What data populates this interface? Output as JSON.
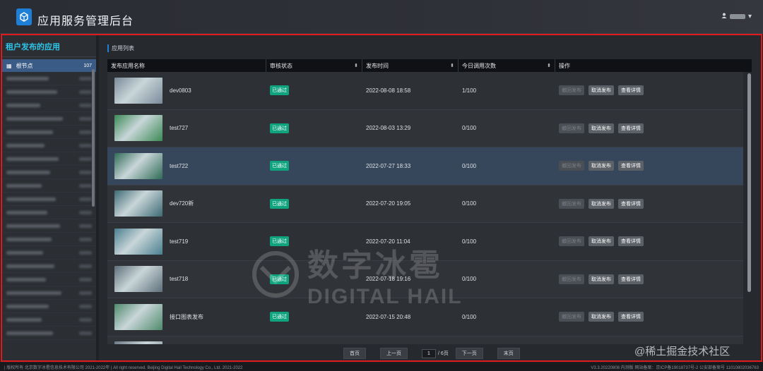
{
  "header": {
    "title": "应用服务管理后台",
    "user_dropdown": "▾"
  },
  "sidebar": {
    "title": "租户发布的应用",
    "root": {
      "icon": "tree-icon",
      "label": "根节点",
      "count": "107"
    },
    "items_count_visible": 20
  },
  "main": {
    "section_title": "应用列表",
    "columns": [
      {
        "label": "发布应用名称",
        "sortable": false
      },
      {
        "label": "审核状态",
        "sortable": true
      },
      {
        "label": "发布时间",
        "sortable": true
      },
      {
        "label": "今日调用次数",
        "sortable": true
      },
      {
        "label": "操作",
        "sortable": false
      }
    ],
    "rows": [
      {
        "name": "dev0803",
        "status": "已通过",
        "time": "2022-08-08 18:58",
        "calls": "1/100",
        "thumb_color": "#7a8a9a"
      },
      {
        "name": "test727",
        "status": "已通过",
        "time": "2022-08-03 13:29",
        "calls": "0/100",
        "thumb_color": "#3b8a55"
      },
      {
        "name": "test722",
        "status": "已通过",
        "time": "2022-07-27 18:33",
        "calls": "0/100",
        "thumb_color": "#2f6b55"
      },
      {
        "name": "dev720新",
        "status": "已通过",
        "time": "2022-07-20 19:05",
        "calls": "0/100",
        "thumb_color": "#3d6a74"
      },
      {
        "name": "test719",
        "status": "已通过",
        "time": "2022-07-20 11:04",
        "calls": "0/100",
        "thumb_color": "#4a7f8f"
      },
      {
        "name": "test718",
        "status": "已通过",
        "time": "2022-07-18 19:16",
        "calls": "0/100",
        "thumb_color": "#5e6f7a"
      },
      {
        "name": "接口图表发布",
        "status": "已通过",
        "time": "2022-07-15 20:48",
        "calls": "0/100",
        "thumb_color": "#4f8a6b"
      },
      {
        "name": "",
        "status": "",
        "time": "",
        "calls": "",
        "thumb_color": "#6c7a86"
      }
    ],
    "actions": {
      "cancel_publish_disabled": "撤回发布",
      "cancel_publish": "取消发布",
      "view_details": "查看详情"
    }
  },
  "pager": {
    "first": "首页",
    "prev": "上一页",
    "current": "1",
    "total": "/ 6页",
    "next": "下一页",
    "last": "末页"
  },
  "footer": {
    "left": "| 版权所有 北京数字冰雹信息技术有限公司 2021-2022年 | All right reserved. Beijing Digital Hail Technology Co., Ltd. 2021-2022",
    "right": "V3.3.20220808 内测版 网站备案：京ICP备19018737号-2 公安部备案号 11010802036763"
  },
  "watermark": {
    "cn": "数字冰雹",
    "en": "DIGITAL HAIL"
  },
  "credit": "@稀土掘金技术社区",
  "colors": {
    "accent": "#1e7fd6",
    "frame": "#e0191d",
    "badge": "#0fa37e",
    "sidebar_title": "#2ec5e8"
  }
}
